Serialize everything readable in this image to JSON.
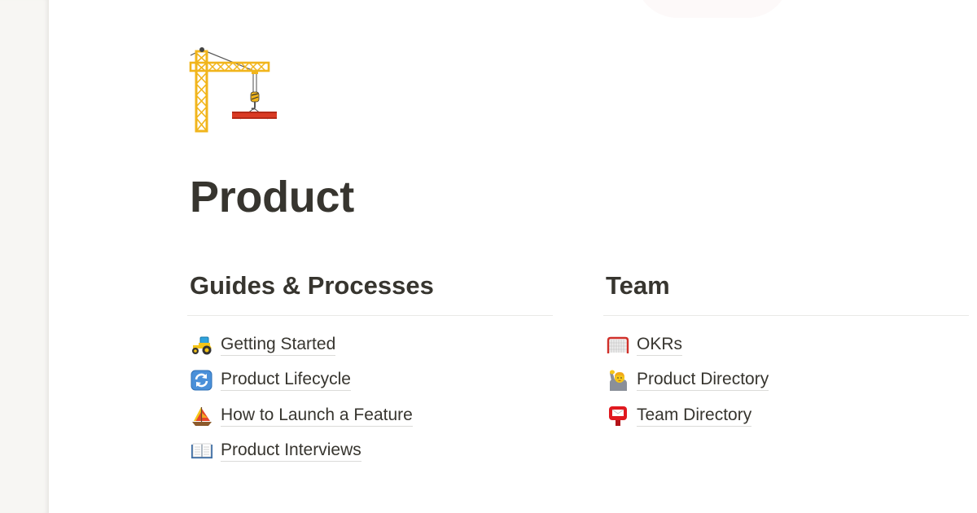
{
  "page": {
    "title": "Product",
    "icon": "construction-crane-icon"
  },
  "sections": [
    {
      "heading": "Guides & Processes",
      "links": [
        {
          "label": "Getting Started",
          "icon": "tractor-icon"
        },
        {
          "label": "Product Lifecycle",
          "icon": "refresh-arrows-icon"
        },
        {
          "label": "How to Launch a Feature",
          "icon": "sailboat-icon"
        },
        {
          "label": "Product Interviews",
          "icon": "open-book-icon"
        }
      ]
    },
    {
      "heading": "Team",
      "links": [
        {
          "label": "OKRs",
          "icon": "goal-net-icon"
        },
        {
          "label": "Product Directory",
          "icon": "person-raising-hand-icon"
        },
        {
          "label": "Team Directory",
          "icon": "postbox-icon"
        }
      ]
    }
  ],
  "colors": {
    "text": "#37352f",
    "sidebar_bg": "#f7f6f3",
    "divider": "#e9e9e7"
  }
}
